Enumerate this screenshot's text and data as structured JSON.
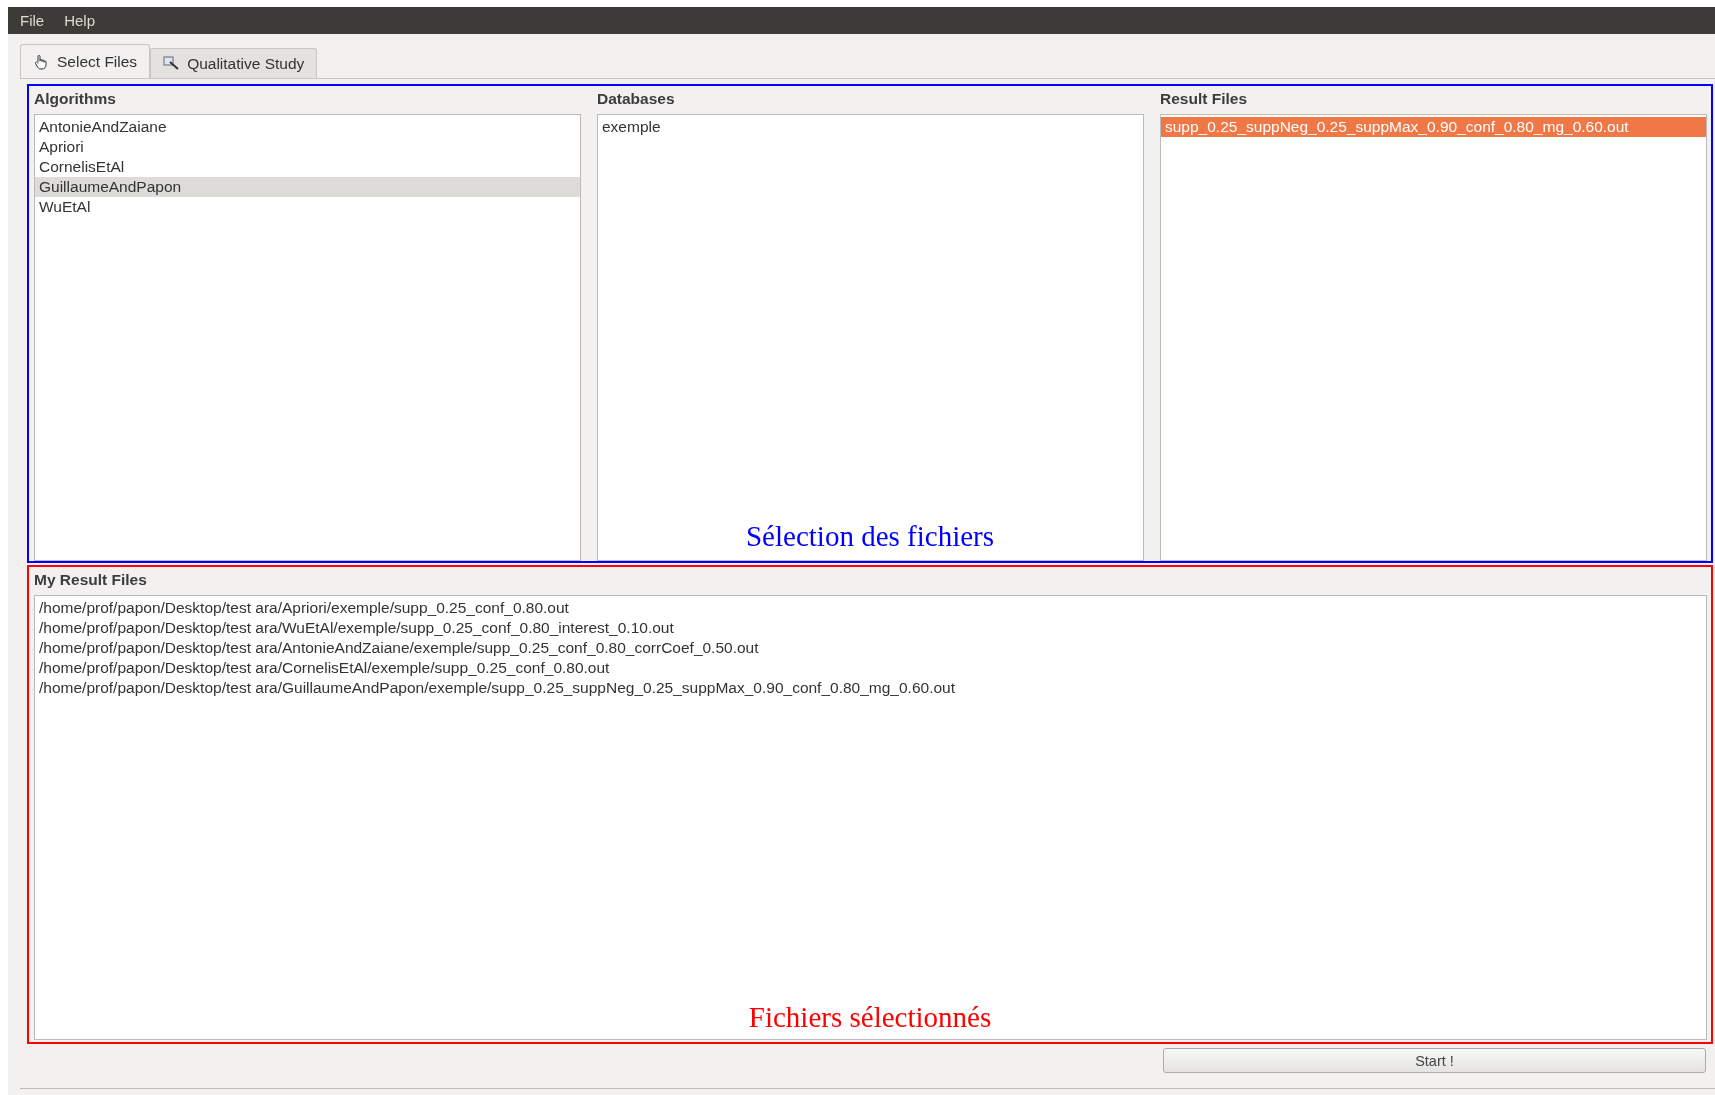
{
  "menu": [
    {
      "label": "File"
    },
    {
      "label": "Help"
    }
  ],
  "tabs": [
    {
      "label": "Select Files",
      "kind": "pointer",
      "selected": true
    },
    {
      "label": "Qualitative Study",
      "kind": "inspect",
      "selected": false
    }
  ],
  "selection_panel": {
    "annotation": "Sélection des fichiers",
    "lists": [
      {
        "title": "Algorithms",
        "items": [
          {
            "label": "AntonieAndZaiane",
            "selected": false
          },
          {
            "label": "Apriori",
            "selected": false
          },
          {
            "label": "CornelisEtAl",
            "selected": false
          },
          {
            "label": "GuillaumeAndPapon",
            "selected": true
          },
          {
            "label": "WuEtAl",
            "selected": false
          }
        ]
      },
      {
        "title": "Databases",
        "items": [
          {
            "label": "exemple",
            "selected": false
          }
        ]
      },
      {
        "title": "Result Files",
        "items": [
          {
            "label": "supp_0.25_suppNeg_0.25_suppMax_0.90_conf_0.80_mg_0.60.out",
            "selected": true
          }
        ]
      }
    ]
  },
  "my_result_files": {
    "title": "My Result Files",
    "annotation": "Fichiers sélectionnés",
    "items": [
      "/home/prof/papon/Desktop/test ara/Apriori/exemple/supp_0.25_conf_0.80.out",
      "/home/prof/papon/Desktop/test ara/WuEtAl/exemple/supp_0.25_conf_0.80_interest_0.10.out",
      "/home/prof/papon/Desktop/test ara/AntonieAndZaiane/exemple/supp_0.25_conf_0.80_corrCoef_0.50.out",
      "/home/prof/papon/Desktop/test ara/CornelisEtAl/exemple/supp_0.25_conf_0.80.out",
      "/home/prof/papon/Desktop/test ara/GuillaumeAndPapon/exemple/supp_0.25_suppNeg_0.25_suppMax_0.90_conf_0.80_mg_0.60.out"
    ]
  },
  "start_button": "Start !"
}
